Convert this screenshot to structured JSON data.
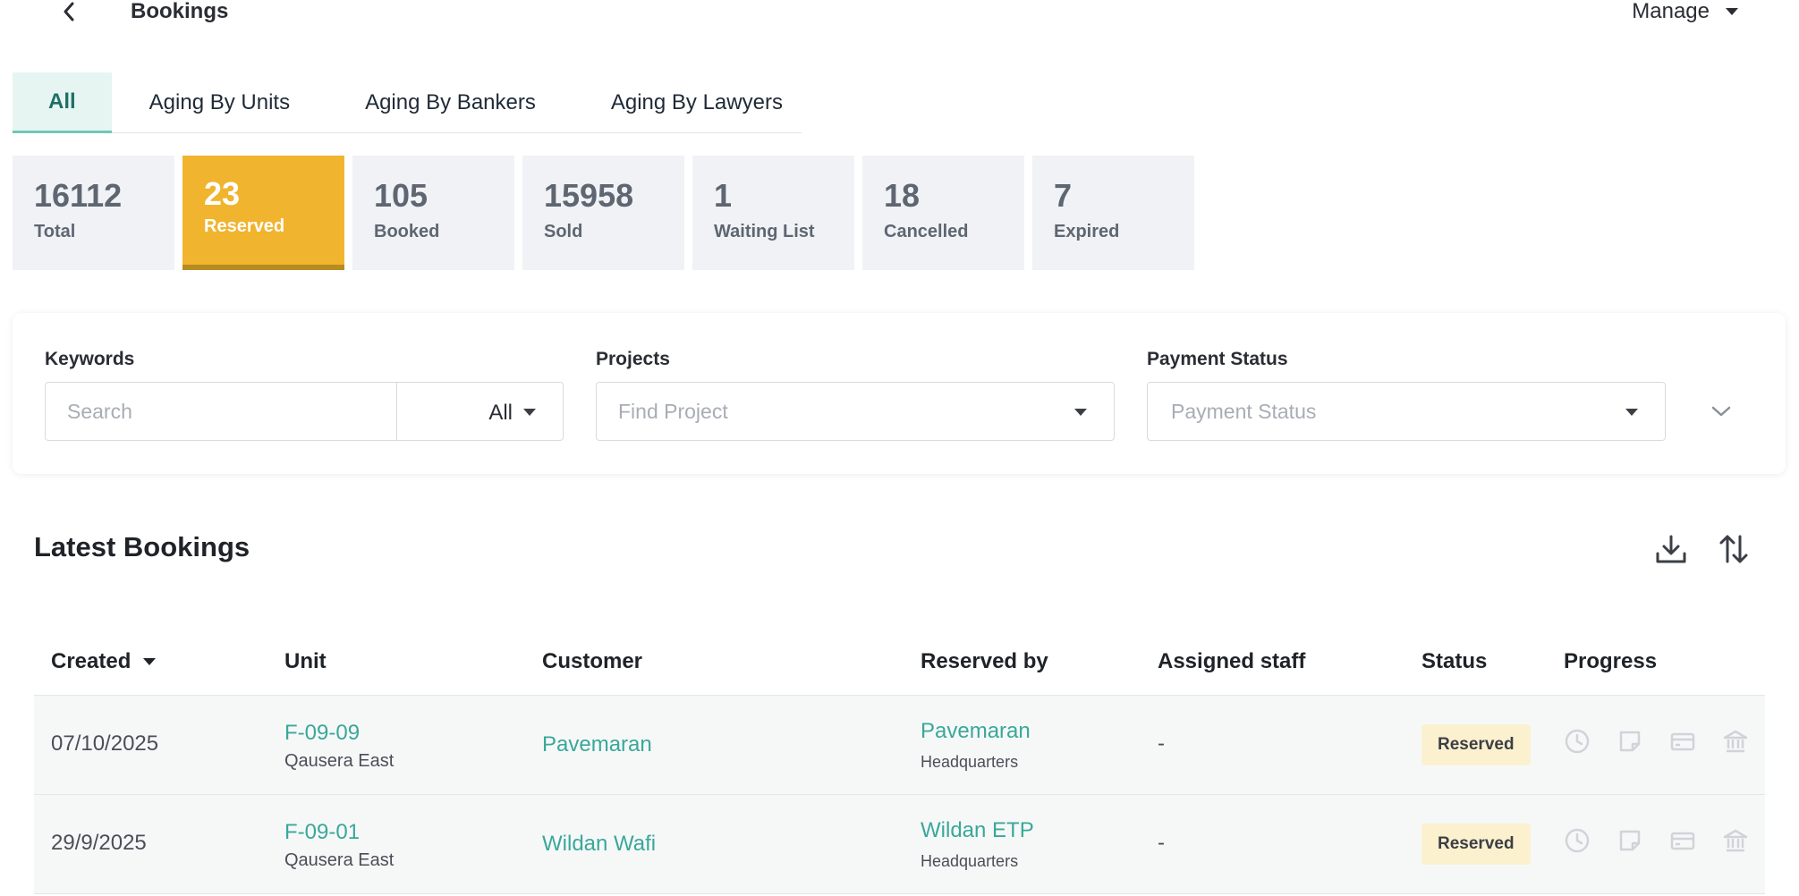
{
  "header": {
    "title": "Bookings",
    "manage_label": "Manage"
  },
  "tabs": [
    {
      "label": "All",
      "active": true
    },
    {
      "label": "Aging By Units"
    },
    {
      "label": "Aging By Bankers"
    },
    {
      "label": "Aging By Lawyers"
    }
  ],
  "stats": [
    {
      "value": "16112",
      "label": "Total"
    },
    {
      "value": "23",
      "label": "Reserved",
      "active": true
    },
    {
      "value": "105",
      "label": "Booked"
    },
    {
      "value": "15958",
      "label": "Sold"
    },
    {
      "value": "1",
      "label": "Waiting List"
    },
    {
      "value": "18",
      "label": "Cancelled"
    },
    {
      "value": "7",
      "label": "Expired"
    }
  ],
  "filters": {
    "keywords_label": "Keywords",
    "search_placeholder": "Search",
    "keyword_scope": "All",
    "projects_label": "Projects",
    "project_placeholder": "Find Project",
    "payment_label": "Payment Status",
    "payment_placeholder": "Payment Status"
  },
  "section": {
    "title": "Latest Bookings"
  },
  "table": {
    "headers": {
      "created": "Created",
      "unit": "Unit",
      "customer": "Customer",
      "reserved_by": "Reserved by",
      "assigned_staff": "Assigned staff",
      "status": "Status",
      "progress": "Progress"
    },
    "rows": [
      {
        "date": "07/10/2025",
        "unit": "F-09-09",
        "project": "Qausera East",
        "customer": "Pavemaran",
        "reserved_by": "Pavemaran",
        "reserved_org": "Headquarters",
        "staff": "-",
        "status": "Reserved"
      },
      {
        "date": "29/9/2025",
        "unit": "F-09-01",
        "project": "Qausera East",
        "customer": "Wildan Wafi",
        "reserved_by": "Wildan ETP",
        "reserved_org": "Headquarters",
        "staff": "-",
        "status": "Reserved"
      }
    ]
  },
  "colors": {
    "accent": "#3aa79a",
    "reserved": "#f0b42e",
    "badge": "#fcf1cf"
  },
  "icons": [
    "chevron-left-icon",
    "caret-down-icon",
    "chevron-down-icon",
    "download-icon",
    "sort-icon",
    "clock-icon",
    "note-icon",
    "card-icon",
    "bank-icon"
  ]
}
